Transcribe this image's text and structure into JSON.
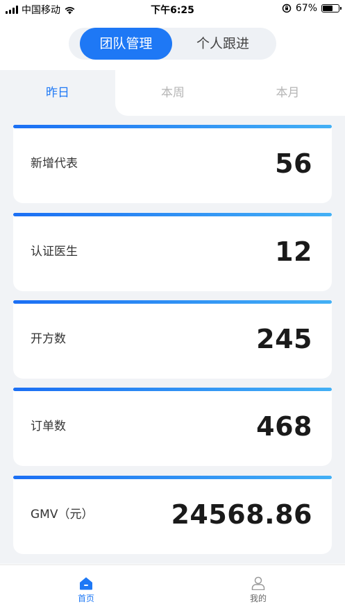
{
  "status_bar": {
    "carrier": "中国移动",
    "time": "下午6:25",
    "battery": "67%",
    "battery_level": 0.67
  },
  "segment": {
    "options": [
      "团队管理",
      "个人跟进"
    ],
    "selected": "团队管理"
  },
  "tabs": {
    "items": [
      "昨日",
      "本周",
      "本月"
    ],
    "selected": "昨日"
  },
  "stats": [
    {
      "label": "新增代表",
      "value": "56"
    },
    {
      "label": "认证医生",
      "value": "12"
    },
    {
      "label": "开方数",
      "value": "245"
    },
    {
      "label": "订单数",
      "value": "468"
    },
    {
      "label": "GMV（元）",
      "value": "24568.86"
    }
  ],
  "bottom_nav": {
    "items": [
      {
        "label": "首页",
        "icon": "home-icon",
        "active": true
      },
      {
        "label": "我的",
        "icon": "user-icon",
        "active": false
      }
    ]
  },
  "colors": {
    "accent": "#1e78f5",
    "panel_bg": "#f1f3f6",
    "bar_start": "#1b6ff4",
    "bar_end": "#43b0f5"
  }
}
